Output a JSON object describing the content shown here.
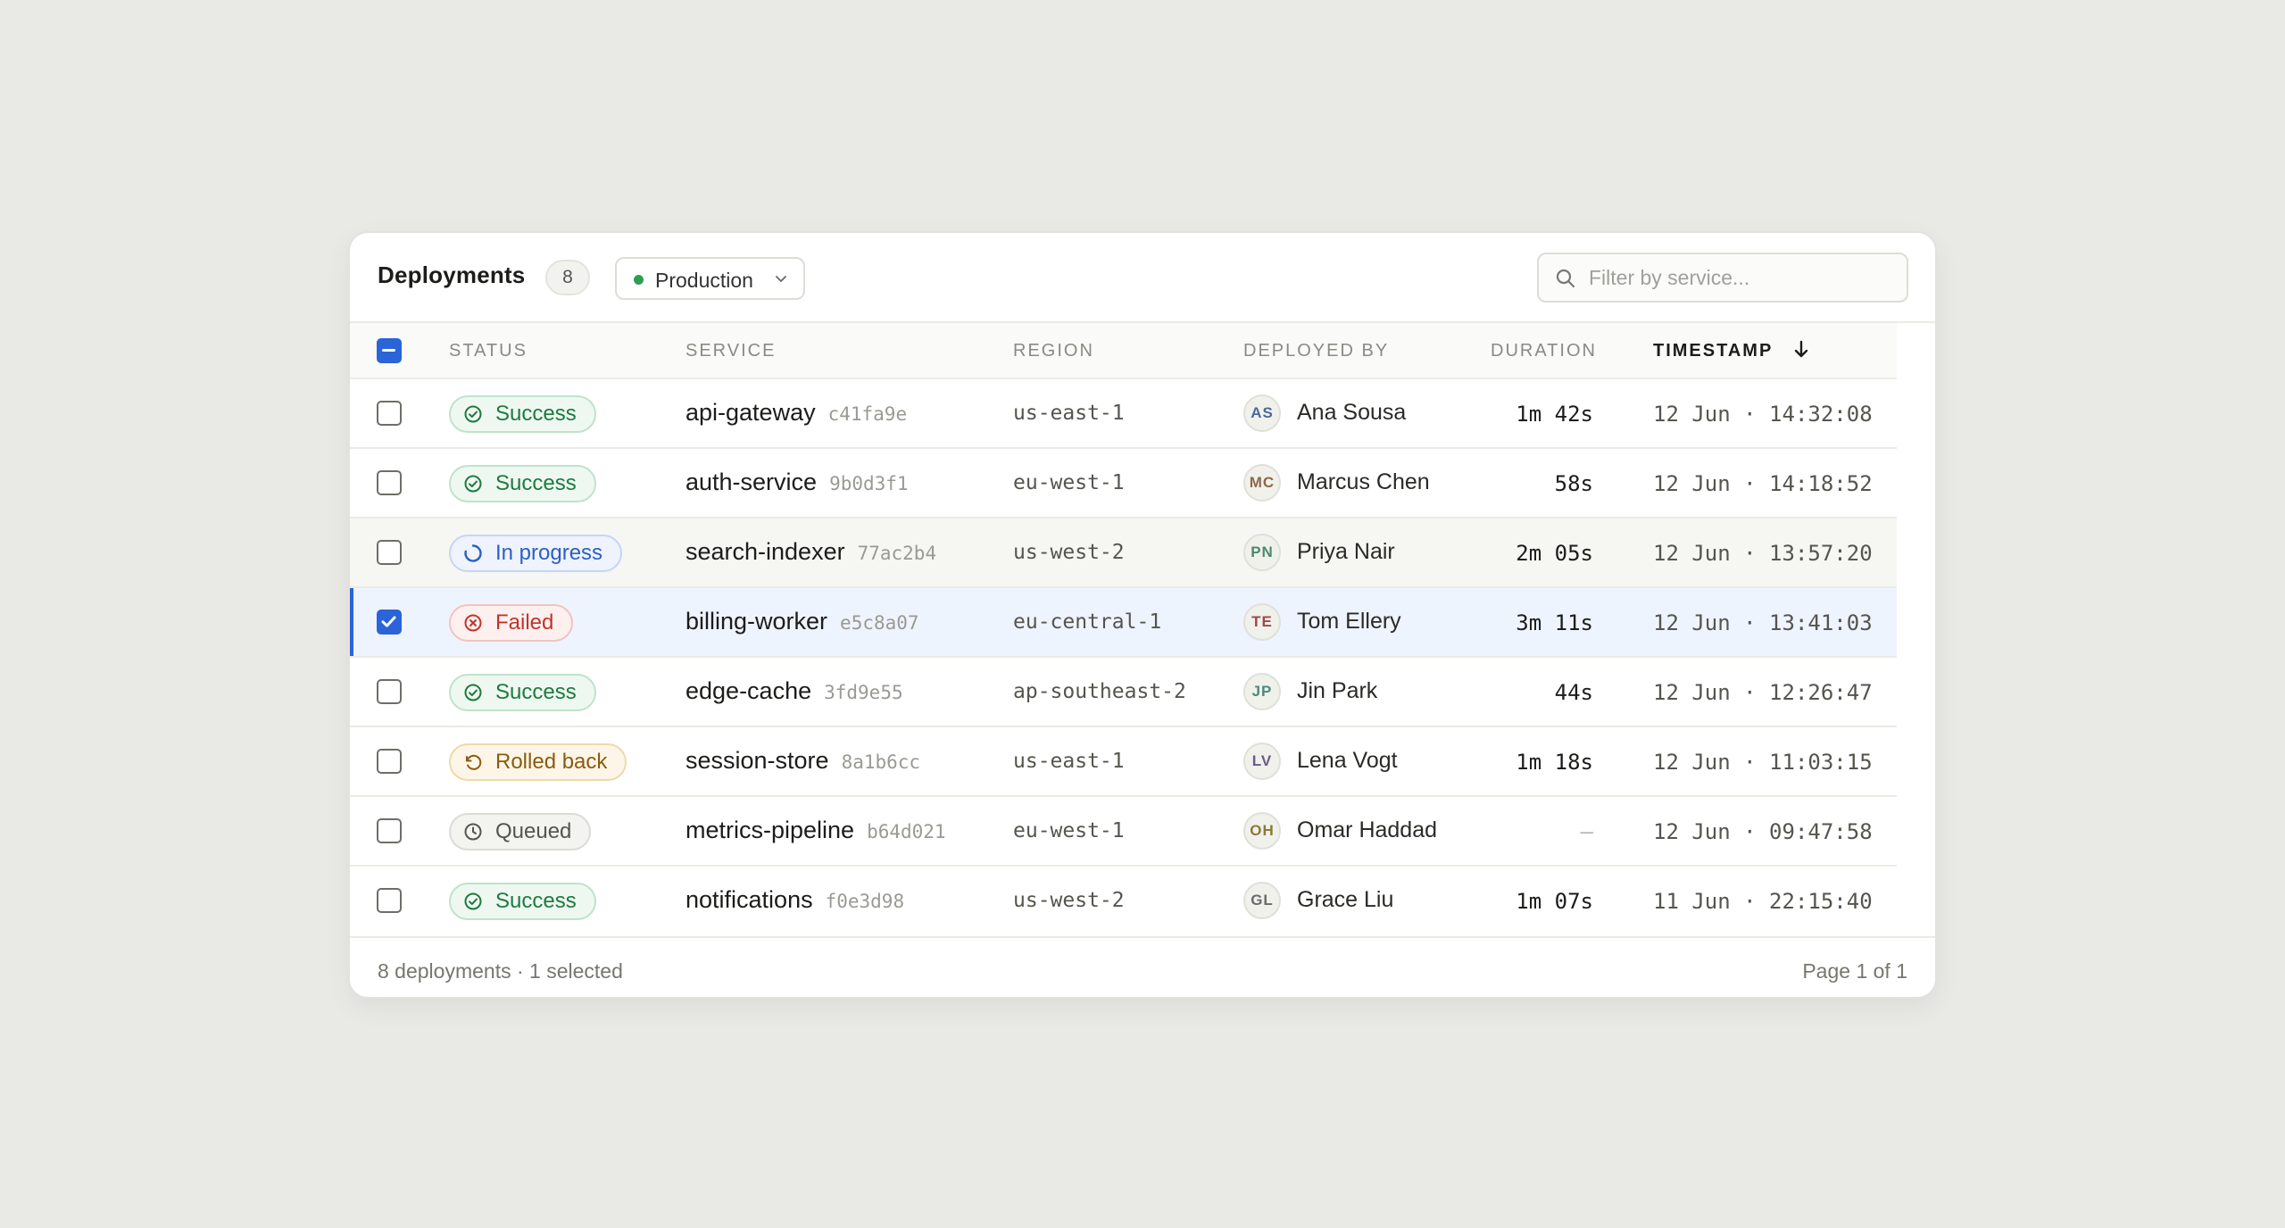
{
  "header": {
    "title": "Deployments",
    "count": "8",
    "environment": "Production",
    "search_placeholder": "Filter by service..."
  },
  "columns": {
    "status": "STATUS",
    "service": "SERVICE",
    "region": "REGION",
    "deployed_by": "DEPLOYED BY",
    "duration": "DURATION",
    "timestamp": "TIMESTAMP"
  },
  "colors": {
    "accent": "#2b63d9",
    "success": "#1e7a3f",
    "in_progress": "#2b5fc4",
    "failed": "#c0342b",
    "rolled_back": "#8a5b10",
    "queued": "#55554f"
  },
  "rows": [
    {
      "status": "Success",
      "status_kind": "success",
      "service": "api-gateway",
      "hash": "c41fa9e",
      "region": "us-east-1",
      "initials": "AS",
      "initials_color": "#4a6a9a",
      "person": "Ana Sousa",
      "duration": "1m 42s",
      "timestamp": "12 Jun · 14:32:08",
      "checked": false
    },
    {
      "status": "Success",
      "status_kind": "success",
      "service": "auth-service",
      "hash": "9b0d3f1",
      "region": "eu-west-1",
      "initials": "MC",
      "initials_color": "#8a6a4a",
      "person": "Marcus Chen",
      "duration": "58s",
      "timestamp": "12 Jun · 14:18:52",
      "checked": false
    },
    {
      "status": "In progress",
      "status_kind": "progress",
      "service": "search-indexer",
      "hash": "77ac2b4",
      "region": "us-west-2",
      "initials": "PN",
      "initials_color": "#4a8a6a",
      "person": "Priya Nair",
      "duration": "2m 05s",
      "timestamp": "12 Jun · 13:57:20",
      "checked": false
    },
    {
      "status": "Failed",
      "status_kind": "failed",
      "service": "billing-worker",
      "hash": "e5c8a07",
      "region": "eu-central-1",
      "initials": "TE",
      "initials_color": "#9a4a4a",
      "person": "Tom Ellery",
      "duration": "3m 11s",
      "timestamp": "12 Jun · 13:41:03",
      "checked": true
    },
    {
      "status": "Success",
      "status_kind": "success",
      "service": "edge-cache",
      "hash": "3fd9e55",
      "region": "ap-southeast-2",
      "initials": "JP",
      "initials_color": "#4a8a7a",
      "person": "Jin Park",
      "duration": "44s",
      "timestamp": "12 Jun · 12:26:47",
      "checked": false
    },
    {
      "status": "Rolled back",
      "status_kind": "rolled",
      "service": "session-store",
      "hash": "8a1b6cc",
      "region": "us-east-1",
      "initials": "LV",
      "initials_color": "#6a5a8a",
      "person": "Lena Vogt",
      "duration": "1m 18s",
      "timestamp": "12 Jun · 11:03:15",
      "checked": false
    },
    {
      "status": "Queued",
      "status_kind": "queued",
      "service": "metrics-pipeline",
      "hash": "b64d021",
      "region": "eu-west-1",
      "initials": "OH",
      "initials_color": "#8a7a3a",
      "person": "Omar Haddad",
      "duration": "—",
      "timestamp": "12 Jun · 09:47:58",
      "checked": false
    },
    {
      "status": "Success",
      "status_kind": "success",
      "service": "notifications",
      "hash": "f0e3d98",
      "region": "us-west-2",
      "initials": "GL",
      "initials_color": "#6a6a6a",
      "person": "Grace Liu",
      "duration": "1m 07s",
      "timestamp": "11 Jun · 22:15:40",
      "checked": false
    }
  ],
  "footer": {
    "summary": "8 deployments · 1 selected",
    "pagination": "Page 1 of 1"
  }
}
